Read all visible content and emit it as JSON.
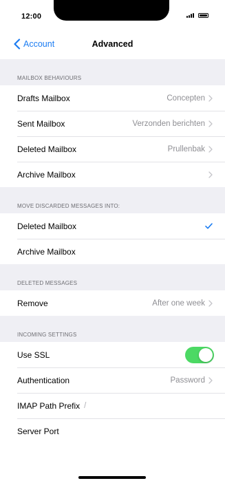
{
  "status_bar": {
    "time": "12:00"
  },
  "nav": {
    "back_label": "Account",
    "title": "Advanced"
  },
  "colors": {
    "accent": "#1b7cf2",
    "toggle_on": "#4cd964",
    "group_background": "#efeff4"
  },
  "sections": {
    "mailbox_behaviours": {
      "header": "MAILBOX BEHAVIOURS",
      "drafts": {
        "label": "Drafts Mailbox",
        "value": "Concepten"
      },
      "sent": {
        "label": "Sent Mailbox",
        "value": "Verzonden berichten"
      },
      "deleted": {
        "label": "Deleted Mailbox",
        "value": "Prullenbak"
      },
      "archive": {
        "label": "Archive Mailbox",
        "value": ""
      }
    },
    "move_discarded": {
      "header": "MOVE DISCARDED MESSAGES INTO:",
      "deleted": {
        "label": "Deleted Mailbox",
        "selected": true
      },
      "archive": {
        "label": "Archive Mailbox",
        "selected": false
      }
    },
    "deleted_messages": {
      "header": "DELETED MESSAGES",
      "remove": {
        "label": "Remove",
        "value": "After one week"
      }
    },
    "incoming_settings": {
      "header": "INCOMING SETTINGS",
      "use_ssl": {
        "label": "Use SSL",
        "enabled": true
      },
      "authentication": {
        "label": "Authentication",
        "value": "Password"
      },
      "imap_path_prefix": {
        "label": "IMAP Path Prefix",
        "value": "/"
      },
      "server_port": {
        "label": "Server Port",
        "value": ""
      }
    }
  },
  "icons": {
    "back": "chevron-left-icon",
    "disclosure": "chevron-right-icon",
    "selected": "checkmark-icon"
  }
}
